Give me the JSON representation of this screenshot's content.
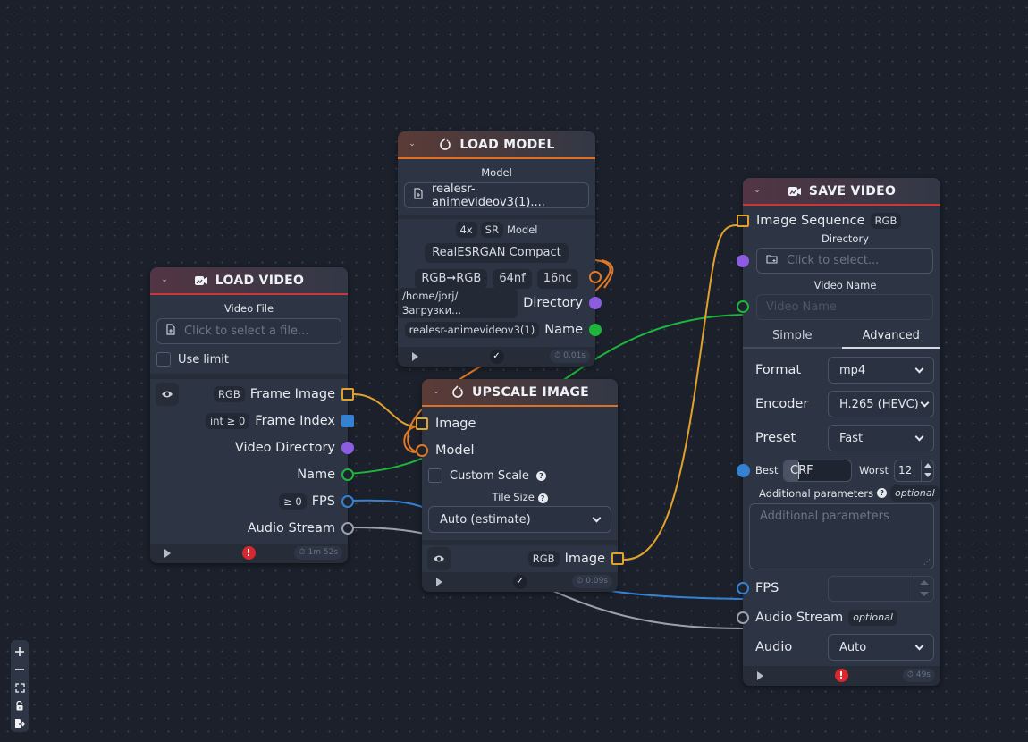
{
  "controls": {
    "zoom_in": "zoom-in",
    "zoom_out": "zoom-out",
    "fit_view": "fit-view",
    "lock": "lock",
    "export": "export"
  },
  "colors": {
    "image": "#e0a22b",
    "model": "#e07825",
    "number": "#3582d3",
    "directory": "#8c5de0",
    "text": "#1db53c",
    "audio": "#9aa1ad",
    "error": "#d8282d"
  },
  "load_video": {
    "title": "LOAD VIDEO",
    "icon": "video-camera-icon",
    "video_file_label": "Video File",
    "video_file_placeholder": "Click to select a file...",
    "use_limit_label": "Use limit",
    "use_limit_checked": false,
    "outputs": [
      {
        "tag": "RGB",
        "label": "Frame Image"
      },
      {
        "tag": "int ≥ 0",
        "label": "Frame Index"
      },
      {
        "tag": "",
        "label": "Video Directory"
      },
      {
        "tag": "",
        "label": "Name"
      },
      {
        "tag": "≥ 0",
        "label": "FPS"
      },
      {
        "tag": "",
        "label": "Audio Stream"
      }
    ],
    "status": "error",
    "status_glyph": "!",
    "timer": "1m 52s"
  },
  "load_model": {
    "title": "LOAD MODEL",
    "icon": "pytorch-icon",
    "model_label": "Model",
    "model_value": "realesr-animevideov3(1)....",
    "tags_scale": "4x",
    "tags_type": "SR",
    "tags_type_suffix": "Model",
    "arch": "RealESRGAN Compact",
    "color_tag": "RGB➞RGB",
    "nf_tag": "64nf",
    "nc_tag": "16nc",
    "outputs": [
      {
        "tag": "/home/jorj/Загрузки...",
        "label": "Directory"
      },
      {
        "tag": "realesr-animevideov3(1)",
        "label": "Name"
      }
    ],
    "status": "ok",
    "status_glyph": "✓",
    "timer": "0.01s"
  },
  "upscale_image": {
    "title": "UPSCALE IMAGE",
    "icon": "pytorch-icon",
    "inputs": [
      {
        "label": "Image"
      },
      {
        "label": "Model"
      }
    ],
    "custom_scale_label": "Custom Scale",
    "custom_scale_checked": false,
    "tile_size_label": "Tile Size",
    "tile_size_value": "Auto (estimate)",
    "output_tag": "RGB",
    "output_label": "Image",
    "status": "ok",
    "status_glyph": "✓",
    "timer": "0.09s"
  },
  "save_video": {
    "title": "SAVE VIDEO",
    "icon": "video-camera-icon",
    "image_sequence_label": "Image Sequence",
    "image_sequence_tag": "RGB",
    "directory_label": "Directory",
    "directory_placeholder": "Click to select...",
    "video_name_label": "Video Name",
    "video_name_placeholder": "Video Name",
    "tabs": [
      "Simple",
      "Advanced"
    ],
    "active_tab": "Advanced",
    "format_label": "Format",
    "format_value": "mp4",
    "encoder_label": "Encoder",
    "encoder_value": "H.265 (HEVC)",
    "preset_label": "Preset",
    "preset_value": "Fast",
    "crf_best_label": "Best",
    "crf_label": "CRF",
    "crf_worst_label": "Worst",
    "crf_value": "12",
    "additional_label": "Additional parameters",
    "additional_tag": "optional",
    "additional_placeholder": "Additional parameters",
    "fps_label": "FPS",
    "fps_value": "",
    "audio_stream_label": "Audio Stream",
    "audio_stream_tag": "optional",
    "audio_label": "Audio",
    "audio_value": "Auto",
    "status": "error",
    "status_glyph": "!",
    "timer": "49s"
  }
}
